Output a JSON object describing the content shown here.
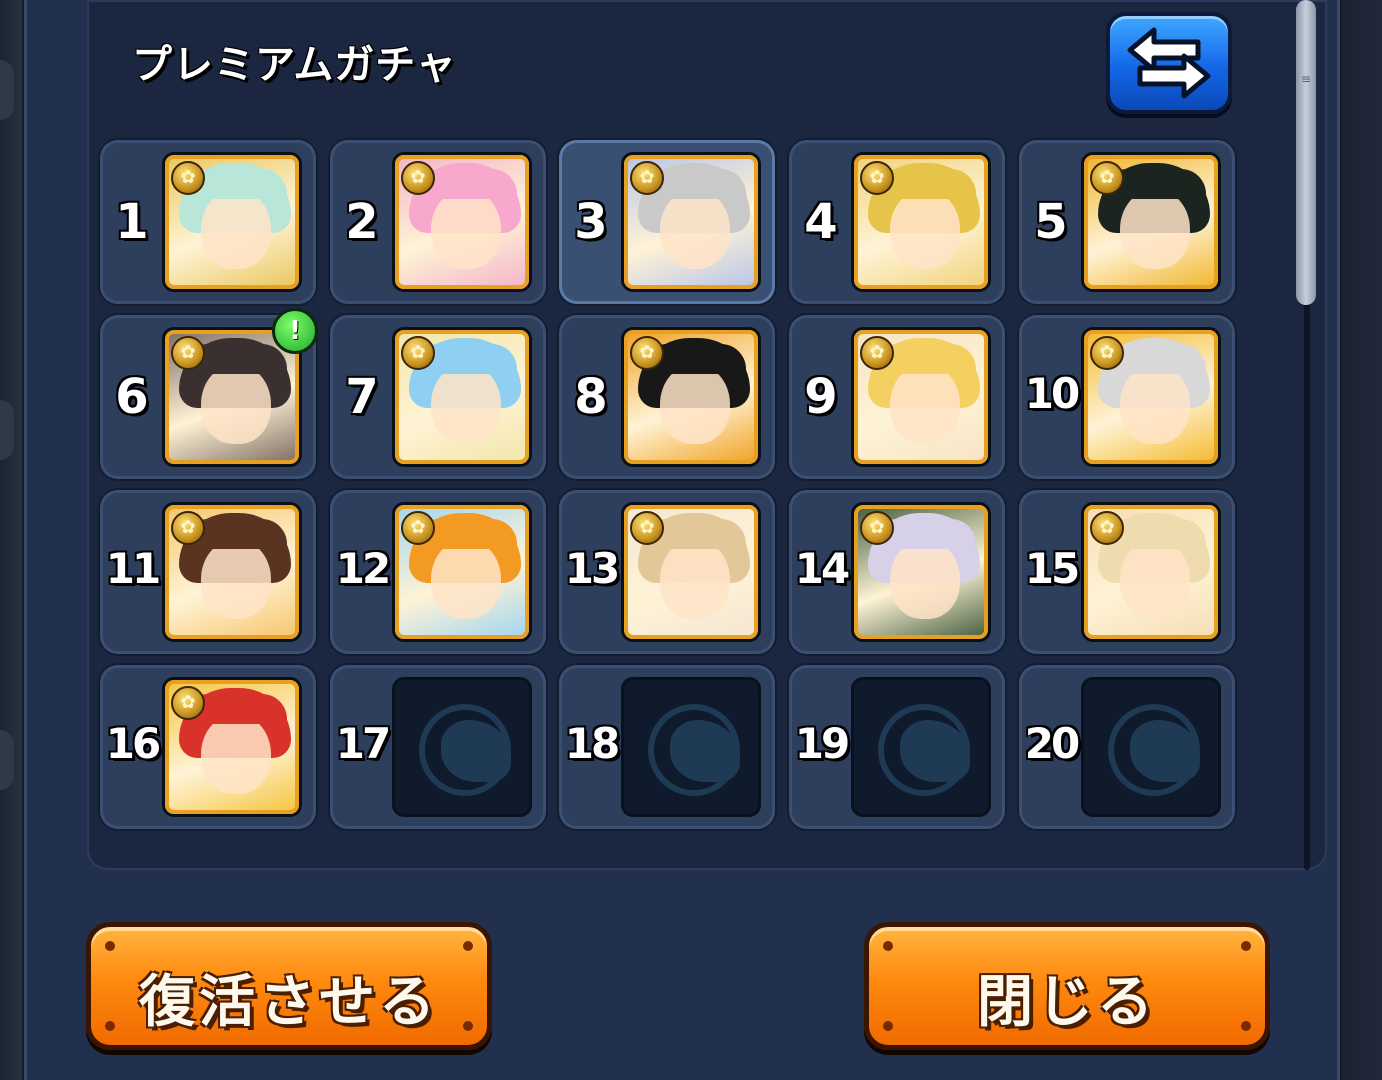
{
  "dialog": {
    "title": "プレミアムガチャ"
  },
  "slots": [
    {
      "number": "1",
      "filled": true,
      "hair": "#b8e6d8",
      "bg": "#e9c65c"
    },
    {
      "number": "2",
      "filled": true,
      "hair": "#f7a8cc",
      "bg": "#f2b3c9"
    },
    {
      "number": "3",
      "filled": true,
      "hair": "#c9c9c9",
      "bg": "#b6c4e8"
    },
    {
      "number": "4",
      "filled": true,
      "hair": "#e6c44a",
      "bg": "#f0d27a"
    },
    {
      "number": "5",
      "filled": true,
      "hair": "#1c2420",
      "bg": "#f0b42a"
    },
    {
      "number": "6",
      "filled": true,
      "hair": "#3a3030",
      "bg": "#7a6a60",
      "alert": true
    },
    {
      "number": "7",
      "filled": true,
      "hair": "#8fd0f2",
      "bg": "#f1e6a8"
    },
    {
      "number": "8",
      "filled": true,
      "hair": "#181818",
      "bg": "#f0a020"
    },
    {
      "number": "9",
      "filled": true,
      "hair": "#f4d060",
      "bg": "#f7e3c4"
    },
    {
      "number": "10",
      "filled": true,
      "hair": "#d8d8d8",
      "bg": "#f3b92a"
    },
    {
      "number": "11",
      "filled": true,
      "hair": "#5a3420",
      "bg": "#f7c46a"
    },
    {
      "number": "12",
      "filled": true,
      "hair": "#f29a22",
      "bg": "#9fd4f0"
    },
    {
      "number": "13",
      "filled": true,
      "hair": "#e2c898",
      "bg": "#f4e6d2"
    },
    {
      "number": "14",
      "filled": true,
      "hair": "#d6d0e8",
      "bg": "#3e5a3a"
    },
    {
      "number": "15",
      "filled": true,
      "hair": "#eedcae",
      "bg": "#f5ddb4"
    },
    {
      "number": "16",
      "filled": true,
      "hair": "#d8322a",
      "bg": "#f4c43a"
    },
    {
      "number": "17",
      "filled": false
    },
    {
      "number": "18",
      "filled": false
    },
    {
      "number": "19",
      "filled": false
    },
    {
      "number": "20",
      "filled": false
    }
  ],
  "alert_icon": "exclamation-icon",
  "alert_symbol": "!",
  "swap_icon": "swap-arrows-icon",
  "empty_icon": "dragon-silhouette-icon",
  "slot_medal_icon": "gold-medal-icon",
  "buttons": {
    "revive_label": "復活させる",
    "close_label": "閉じる"
  },
  "colors": {
    "button_orange": "#ff8a10",
    "swap_blue": "#1467e8",
    "panel_navy": "#22304f",
    "alert_green": "#1fa82a"
  }
}
